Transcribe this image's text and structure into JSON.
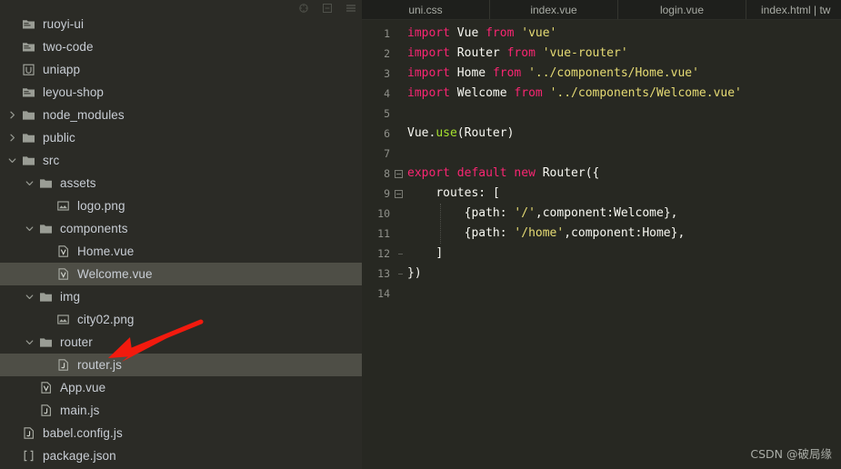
{
  "sidebar": {
    "toolbar_icons": [
      {
        "name": "locate-icon",
        "glyph": "target"
      },
      {
        "name": "collapse-all-icon",
        "glyph": "collapse"
      },
      {
        "name": "options-menu-icon",
        "glyph": "hamburger"
      }
    ],
    "tree": [
      {
        "label": "ruoyi-ui",
        "depth": 0,
        "icon": "module-folder-icon",
        "arrow": "none",
        "selected": false
      },
      {
        "label": "two-code",
        "depth": 0,
        "icon": "module-folder-icon",
        "arrow": "none",
        "selected": false
      },
      {
        "label": "uniapp",
        "depth": 0,
        "icon": "uniapp-module-icon",
        "arrow": "none",
        "selected": false
      },
      {
        "label": "leyou-shop",
        "depth": 0,
        "icon": "module-folder-icon",
        "arrow": "none",
        "selected": false
      },
      {
        "label": "node_modules",
        "depth": 1,
        "icon": "folder-icon",
        "arrow": "collapsed",
        "selected": false
      },
      {
        "label": "public",
        "depth": 1,
        "icon": "folder-icon",
        "arrow": "collapsed",
        "selected": false
      },
      {
        "label": "src",
        "depth": 1,
        "icon": "folder-icon",
        "arrow": "expanded",
        "selected": false
      },
      {
        "label": "assets",
        "depth": 2,
        "icon": "folder-icon",
        "arrow": "expanded",
        "selected": false
      },
      {
        "label": "logo.png",
        "depth": 3,
        "icon": "image-file-icon",
        "arrow": "none",
        "selected": false
      },
      {
        "label": "components",
        "depth": 2,
        "icon": "folder-icon",
        "arrow": "expanded",
        "selected": false
      },
      {
        "label": "Home.vue",
        "depth": 3,
        "icon": "vue-file-icon",
        "arrow": "none",
        "selected": false
      },
      {
        "label": "Welcome.vue",
        "depth": 3,
        "icon": "vue-file-icon",
        "arrow": "none",
        "selected": true
      },
      {
        "label": "img",
        "depth": 2,
        "icon": "folder-icon",
        "arrow": "expanded",
        "selected": false
      },
      {
        "label": "city02.png",
        "depth": 3,
        "icon": "image-file-icon",
        "arrow": "none",
        "selected": false
      },
      {
        "label": "router",
        "depth": 2,
        "icon": "folder-icon",
        "arrow": "expanded",
        "selected": false
      },
      {
        "label": "router.js",
        "depth": 3,
        "icon": "js-file-icon",
        "arrow": "none",
        "selected": true
      },
      {
        "label": "App.vue",
        "depth": 2,
        "icon": "vue-file-icon",
        "arrow": "none",
        "selected": false
      },
      {
        "label": "main.js",
        "depth": 2,
        "icon": "js-file-icon",
        "arrow": "none",
        "selected": false
      },
      {
        "label": "babel.config.js",
        "depth": 1,
        "icon": "js-file-icon",
        "arrow": "none",
        "selected": false
      },
      {
        "label": "package.json",
        "depth": 1,
        "icon": "json-file-icon",
        "arrow": "none",
        "selected": false
      }
    ],
    "annotation": {
      "name": "red-arrow-annotation",
      "color": "#f21a0e",
      "points_to": "router.js"
    }
  },
  "editor": {
    "tabs": [
      {
        "label": "uni.css",
        "active": false
      },
      {
        "label": "index.vue",
        "active": false
      },
      {
        "label": "login.vue",
        "active": false
      },
      {
        "label": "index.html | tw",
        "active": false
      }
    ],
    "lines": [
      {
        "num": "1",
        "fold": "",
        "text": "import Vue from 'vue'"
      },
      {
        "num": "2",
        "fold": "",
        "text": "import Router from 'vue-router'"
      },
      {
        "num": "3",
        "fold": "",
        "text": "import Home from '../components/Home.vue'"
      },
      {
        "num": "4",
        "fold": "",
        "text": "import Welcome from '../components/Welcome.vue'"
      },
      {
        "num": "5",
        "fold": "",
        "text": ""
      },
      {
        "num": "6",
        "fold": "",
        "text": "Vue.use(Router)"
      },
      {
        "num": "7",
        "fold": "",
        "text": ""
      },
      {
        "num": "8",
        "fold": "open",
        "text": "export default new Router({"
      },
      {
        "num": "9",
        "fold": "open",
        "text": "    routes: ["
      },
      {
        "num": "10",
        "fold": "line",
        "text": "        {path: '/',component:Welcome},"
      },
      {
        "num": "11",
        "fold": "line",
        "text": "        {path: '/home',component:Home},"
      },
      {
        "num": "12",
        "fold": "tick",
        "text": "    ]"
      },
      {
        "num": "13",
        "fold": "end",
        "text": "})"
      },
      {
        "num": "14",
        "fold": "",
        "text": ""
      }
    ]
  },
  "watermark": {
    "text": "CSDN @破局缘"
  },
  "colors": {
    "sidebar_bg": "#2b2b26",
    "editor_bg": "#272822",
    "tabbar_bg": "#1e1f1c",
    "selection_bg": "#4e4e46",
    "keyword": "#f92672",
    "string": "#e6db74",
    "function": "#a6e22e",
    "plain": "#f8f8f2",
    "gutter": "#8f908a",
    "tree_text": "#c8cdd4",
    "annotation_red": "#f21a0e"
  }
}
